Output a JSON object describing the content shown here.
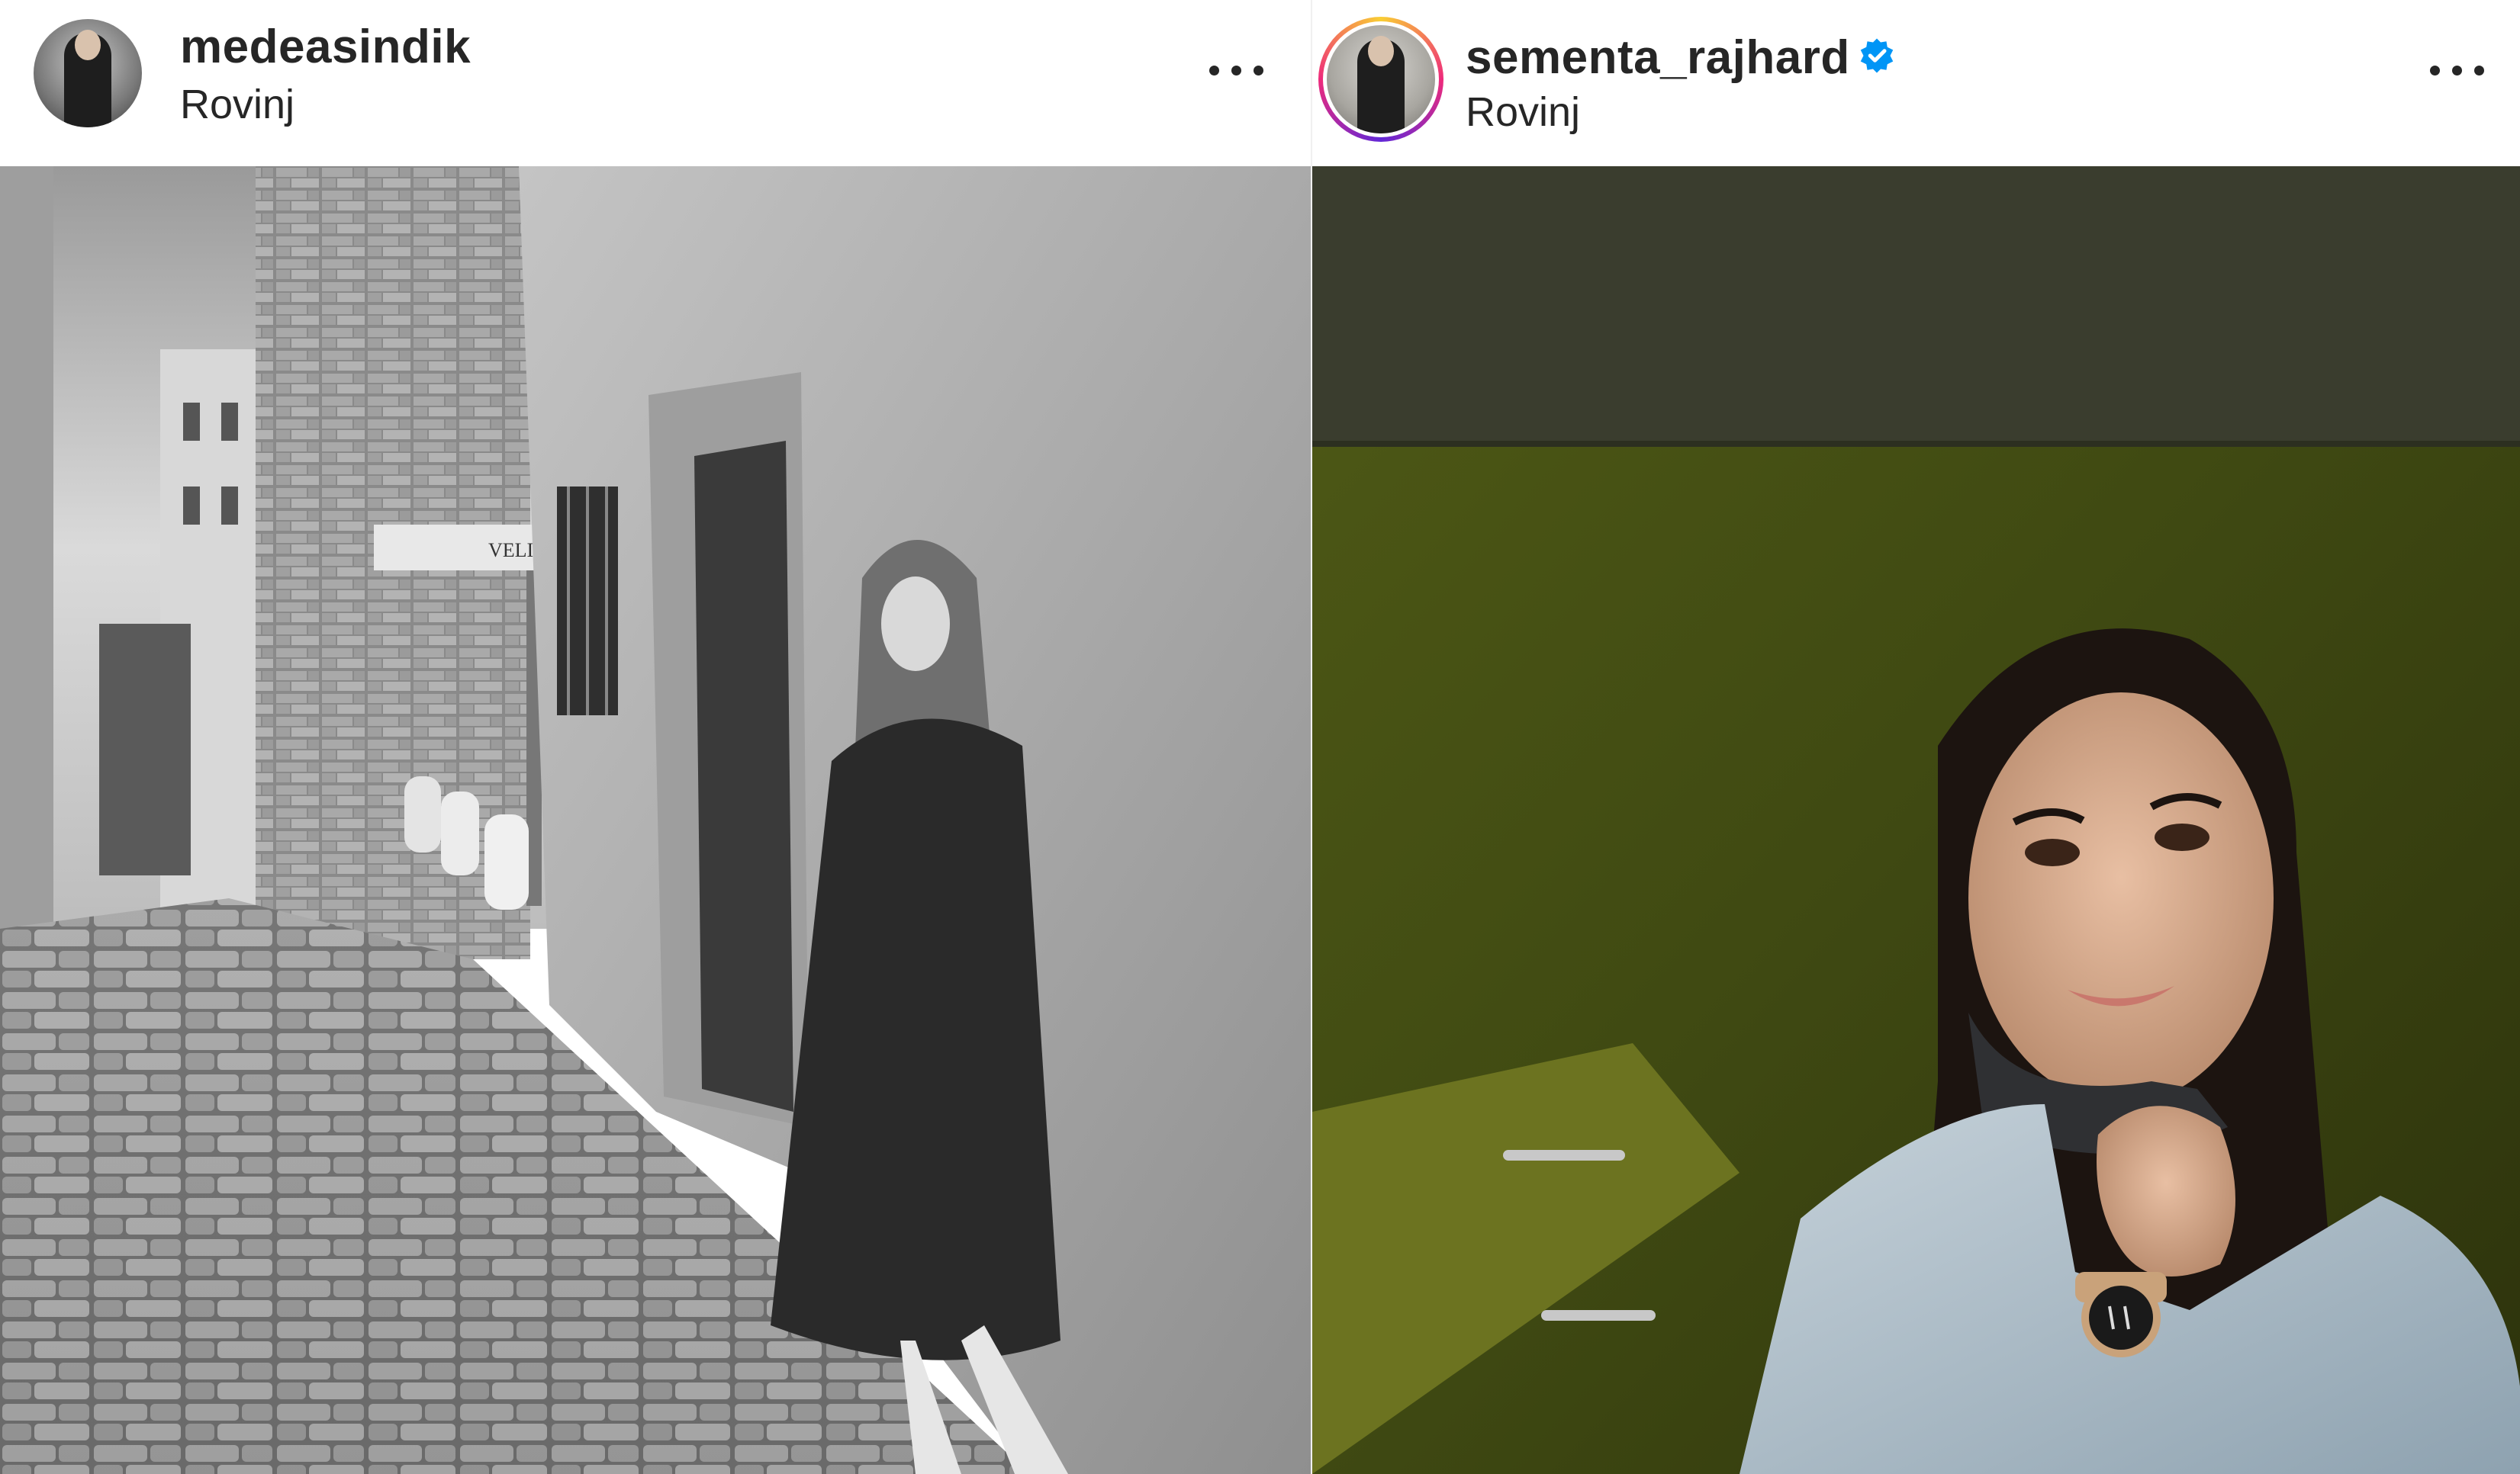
{
  "posts": [
    {
      "username": "medeasindik",
      "location": "Rovinj",
      "photo": {
        "style": "black-and-white",
        "subject": "woman in fur coat on cobblestone street",
        "sign_text": "VELI"
      }
    },
    {
      "username": "sementa_rajhard",
      "verified": true,
      "location": "Rovinj",
      "photo": {
        "style": "color",
        "subject": "selfie of woman in denim jacket with watch"
      }
    }
  ],
  "icons": {
    "more": "more-horizontal-icon",
    "verified": "verified-badge-icon"
  },
  "colors": {
    "text": "#262626",
    "verified": "#0095f6",
    "header_bg": "#ffffff"
  }
}
